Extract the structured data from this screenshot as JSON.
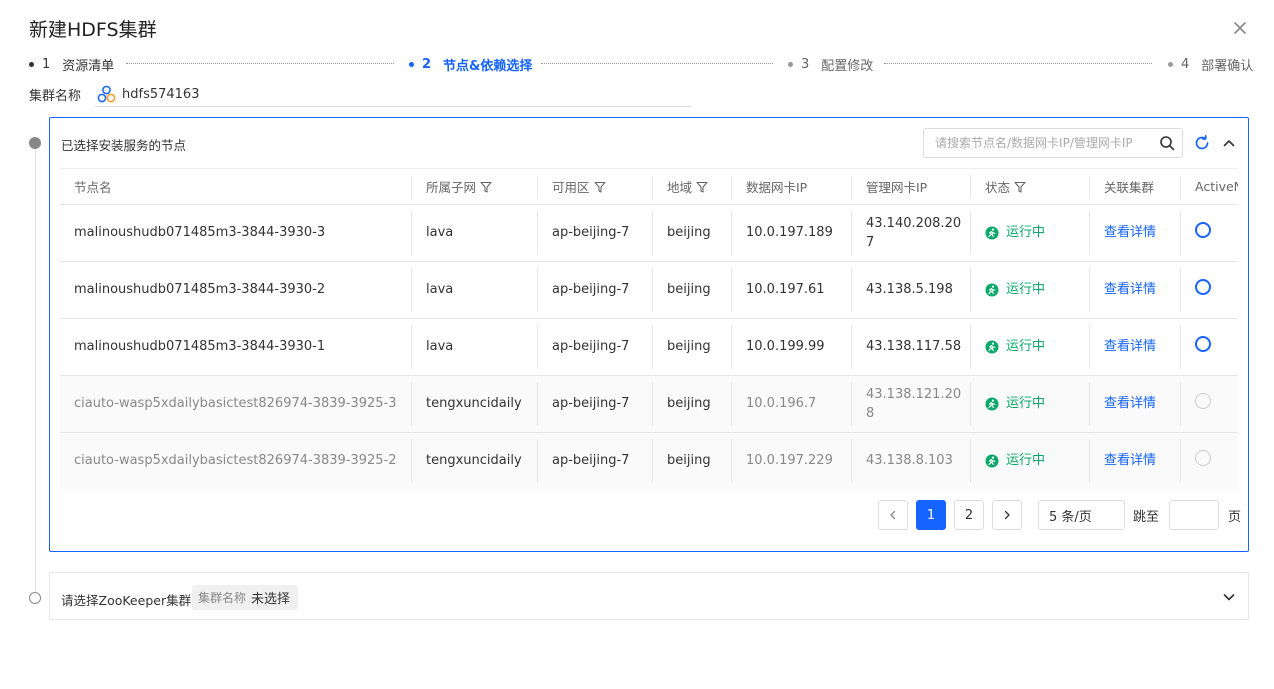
{
  "dialog": {
    "title": "新建HDFS集群"
  },
  "steps": [
    {
      "num": "1",
      "label": "资源清单",
      "state": "done"
    },
    {
      "num": "2",
      "label": "节点&依赖选择",
      "state": "active"
    },
    {
      "num": "3",
      "label": "配置修改",
      "state": "pending"
    },
    {
      "num": "4",
      "label": "部署确认",
      "state": "pending"
    }
  ],
  "cluster": {
    "label": "集群名称",
    "value": "hdfs574163"
  },
  "nodes_panel": {
    "title": "已选择安装服务的节点",
    "search_placeholder": "请搜索节点名/数据网卡IP/管理网卡IP",
    "columns": [
      "节点名",
      "所属子网",
      "可用区",
      "地域",
      "数据网卡IP",
      "管理网卡IP",
      "状态",
      "关联集群",
      "ActiveN"
    ],
    "rows": [
      {
        "name": "malinoushudb071485m3-3844-3930-3",
        "subnet": "lava",
        "zone": "ap-beijing-7",
        "region": "beijing",
        "data_ip": "10.0.197.189",
        "mgmt_ip": "43.140.208.207",
        "status": "运行中",
        "link": "查看详情",
        "disabled": false
      },
      {
        "name": "malinoushudb071485m3-3844-3930-2",
        "subnet": "lava",
        "zone": "ap-beijing-7",
        "region": "beijing",
        "data_ip": "10.0.197.61",
        "mgmt_ip": "43.138.5.198",
        "status": "运行中",
        "link": "查看详情",
        "disabled": false
      },
      {
        "name": "malinoushudb071485m3-3844-3930-1",
        "subnet": "lava",
        "zone": "ap-beijing-7",
        "region": "beijing",
        "data_ip": "10.0.199.99",
        "mgmt_ip": "43.138.117.58",
        "status": "运行中",
        "link": "查看详情",
        "disabled": false
      },
      {
        "name": "ciauto-wasp5xdailybasictest826974-3839-3925-3",
        "subnet": "tengxuncidaily",
        "zone": "ap-beijing-7",
        "region": "beijing",
        "data_ip": "10.0.196.7",
        "mgmt_ip": "43.138.121.208",
        "status": "运行中",
        "link": "查看详情",
        "disabled": true
      },
      {
        "name": "ciauto-wasp5xdailybasictest826974-3839-3925-2",
        "subnet": "tengxuncidaily",
        "zone": "ap-beijing-7",
        "region": "beijing",
        "data_ip": "10.0.197.229",
        "mgmt_ip": "43.138.8.103",
        "status": "运行中",
        "link": "查看详情",
        "disabled": true
      }
    ],
    "pagination": {
      "pages": [
        "1",
        "2"
      ],
      "current": "1",
      "page_size": "5 条/页",
      "jump_label": "跳至",
      "page_unit": "页"
    }
  },
  "zk_panel": {
    "title": "请选择ZooKeeper集群",
    "tag_key": "集群名称",
    "tag_value": "未选择"
  },
  "colors": {
    "accent": "#1664ff",
    "success": "#0aa96a"
  }
}
